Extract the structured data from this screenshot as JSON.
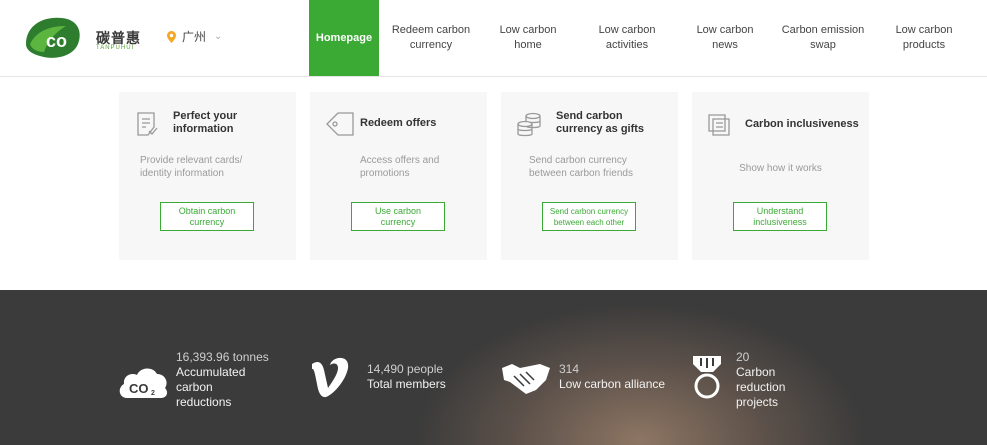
{
  "header": {
    "brand_name": "碳普惠",
    "brand_sub": "TANPUHUI",
    "location": "广州",
    "nav": [
      {
        "label": "Homepage",
        "active": true
      },
      {
        "label": "Redeem carbon\ncurrency"
      },
      {
        "label": "Low carbon\nhome"
      },
      {
        "label": "Low carbon\nactivities"
      },
      {
        "label": "Low carbon\nnews"
      },
      {
        "label": "Carbon emission\nswap"
      },
      {
        "label": "Low carbon\nproducts"
      }
    ]
  },
  "cards": [
    {
      "title": "Perfect your\ninformation",
      "desc": "Provide relevant cards/\nidentity information",
      "button": "Obtain carbon\ncurrency",
      "icon": "form-icon"
    },
    {
      "title": "Redeem offers",
      "desc": "Access offers and\npromotions",
      "button": "Use carbon\ncurrency",
      "icon": "tag-icon"
    },
    {
      "title": "Send carbon\ncurrency as gifts",
      "desc": "Send carbon currency\nbetween carbon friends",
      "button": "Send carbon currency\nbetween each other",
      "icon": "coins-icon"
    },
    {
      "title": "Carbon inclusiveness",
      "desc": "Show how it works",
      "button": "Understand\ninclusiveness",
      "icon": "document-icon"
    }
  ],
  "stats": [
    {
      "number": "16,393.96 tonnes",
      "label": "Accumulated carbon\nreductions",
      "icon": "co2-cloud-icon"
    },
    {
      "number": "14,490 people",
      "label": "Total members",
      "icon": "v-icon"
    },
    {
      "number": "314",
      "label": "Low carbon alliance",
      "icon": "handshake-icon"
    },
    {
      "number": "20",
      "label": "Carbon reduction\nprojects",
      "icon": "medal-icon"
    }
  ],
  "colors": {
    "accent": "#3aaa35",
    "band": "#3a3a3a"
  }
}
